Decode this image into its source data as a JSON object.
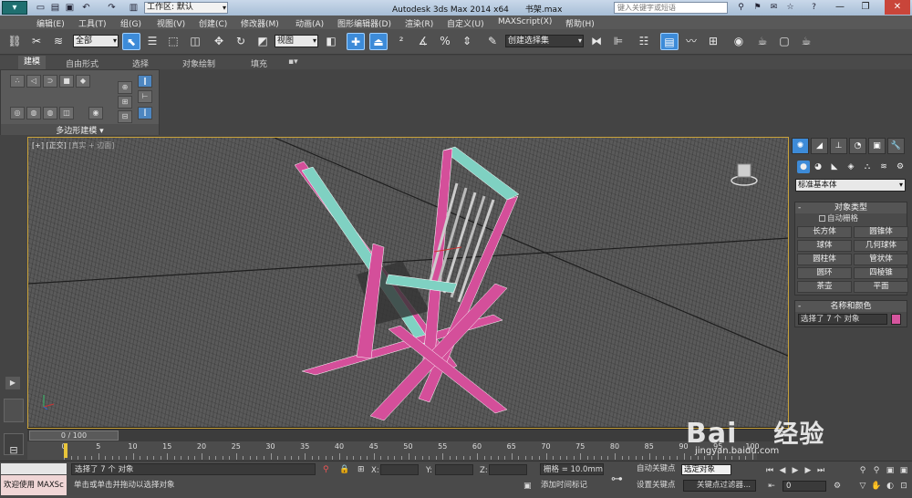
{
  "titlebar": {
    "workspace_label": "工作区: 默认",
    "app_title": "Autodesk 3ds Max  2014 x64",
    "file_name": "书架.max",
    "search_placeholder": "键入关键字或短语"
  },
  "menu": {
    "items": [
      "编辑(E)",
      "工具(T)",
      "组(G)",
      "视图(V)",
      "创建(C)",
      "修改器(M)",
      "动画(A)",
      "图形编辑器(D)",
      "渲染(R)",
      "自定义(U)",
      "MAXScript(X)",
      "帮助(H)"
    ]
  },
  "toolbar": {
    "selection_filter": "全部",
    "coord_system": "视图",
    "named_selection": "创建选择集"
  },
  "ribbon": {
    "tabs": [
      "建模",
      "自由形式",
      "选择",
      "对象绘制",
      "填充"
    ],
    "panel_label": "多边形建模 ▾"
  },
  "viewport": {
    "label_plus": "[+]",
    "label_view": "[正交]",
    "label_shading": "[真实 + 边面]"
  },
  "command_panel": {
    "category": "标准基本体",
    "object_type_header": "对象类型",
    "autogrid_label": "自动栅格",
    "object_buttons": [
      "长方体",
      "圆锥体",
      "球体",
      "几何球体",
      "圆柱体",
      "管状体",
      "圆环",
      "四棱锥",
      "茶壶",
      "平面"
    ],
    "name_color_header": "名称和颜色",
    "name_value": "选择了 7 个 对象",
    "object_color": "#d6559e"
  },
  "timeline": {
    "frame_display": "0 / 100",
    "ticks": [
      "0",
      "5",
      "10",
      "15",
      "20",
      "25",
      "30",
      "35",
      "40",
      "45",
      "50",
      "55",
      "60",
      "65",
      "70",
      "75",
      "80",
      "85",
      "90",
      "95",
      "100"
    ]
  },
  "status": {
    "welcome": "欢迎使用 MAXSc",
    "selection_info": "选择了 7 个 对象",
    "prompt": "单击或单击并拖动以选择对象",
    "x_label": "X:",
    "y_label": "Y:",
    "z_label": "Z:",
    "grid": "栅格 = 10.0mm",
    "add_time_tag": "添加时间标记",
    "auto_key": "自动关键点",
    "set_key": "设置关键点",
    "selected_dropdown": "选定对象",
    "key_filters": "关键点过滤器...",
    "frame": "0"
  },
  "watermark": {
    "brand": "Bai",
    "brand_suffix": "经验",
    "url": "jingyan.baidu.com"
  }
}
